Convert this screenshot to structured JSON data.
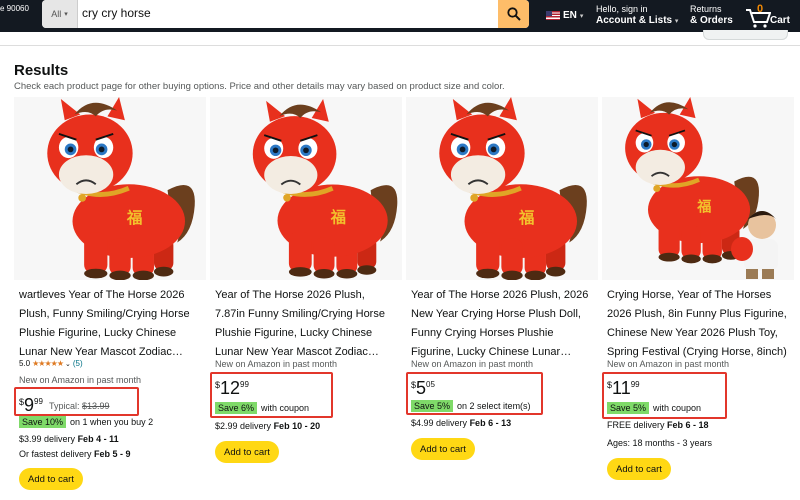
{
  "header": {
    "location": "e 90060",
    "search_category": "All",
    "search_query": "cry cry horse",
    "language": "EN",
    "account_line1": "Hello, sign in",
    "account_line2": "Account & Lists",
    "returns_line1": "Returns",
    "returns_line2": "& Orders",
    "cart_count": "0",
    "cart_label": "Cart"
  },
  "results": {
    "title": "Results",
    "subtitle": "Check each product page for other buying options. Price and other details may vary based on product size and color."
  },
  "products": [
    {
      "title": "wartleves Year of The Horse 2026 Plush, Funny Smiling/Crying Horse Plushie Figurine, Lucky Chinese Lunar New Year Mascot Zodiac…",
      "rating_value": "5.0",
      "rating_count": "(5)",
      "new_label": "New on Amazon in past month",
      "price_symbol": "$",
      "price_whole": "9",
      "price_fraction": "99",
      "typical_label": "Typical:",
      "typical_price": "$13.99",
      "save_badge": "Save 10%",
      "save_text": "on 1 when you buy 2",
      "delivery_prefix": "$3.99 delivery",
      "delivery_date": "Feb 4 - 11",
      "fastest_prefix": "Or fastest delivery",
      "fastest_date": "Feb 5 - 9",
      "add_to_cart": "Add to cart"
    },
    {
      "title": "Year of The Horse 2026 Plush, 7.87in Funny Smiling/Crying Horse Plushie Figurine, Lucky Chinese Lunar New Year Mascot Zodiac…",
      "new_label": "New on Amazon in past month",
      "price_symbol": "$",
      "price_whole": "12",
      "price_fraction": "99",
      "save_badge": "Save 6%",
      "save_text": "with coupon",
      "delivery_prefix": "$2.99 delivery",
      "delivery_date": "Feb 10 - 20",
      "add_to_cart": "Add to cart"
    },
    {
      "title": "Year of The Horse 2026 Plush, 2026 New Year Crying Horse Plush Doll, Funny Crying Horses Plushie Figurine, Lucky Chinese Lunar…",
      "new_label": "New on Amazon in past month",
      "price_symbol": "$",
      "price_whole": "5",
      "price_fraction": "05",
      "save_badge": "Save 5%",
      "save_text": "on 2 select item(s)",
      "delivery_prefix": "$4.99 delivery",
      "delivery_date": "Feb 6 - 13",
      "add_to_cart": "Add to cart"
    },
    {
      "title": "Crying Horse, Year of The Horses 2026 Plush, 8in Funny Plus Figurine, Chinese New Year 2026 Plush Toy, Spring Festival (Crying Horse, 8inch)",
      "new_label": "New on Amazon in past month",
      "price_symbol": "$",
      "price_whole": "11",
      "price_fraction": "99",
      "save_badge": "Save 5%",
      "save_text": "with coupon",
      "delivery_prefix": "FREE delivery",
      "delivery_date": "Feb 6 - 18",
      "ages": "Ages: 18 months - 3 years",
      "add_to_cart": "Add to cart"
    }
  ],
  "colors": {
    "nav_bg": "#131921",
    "search_button": "#febd69",
    "add_to_cart": "#ffd814",
    "save_badge": "#7fda69",
    "highlight_box": "#e2362b",
    "plush_red": "#e8301d"
  }
}
